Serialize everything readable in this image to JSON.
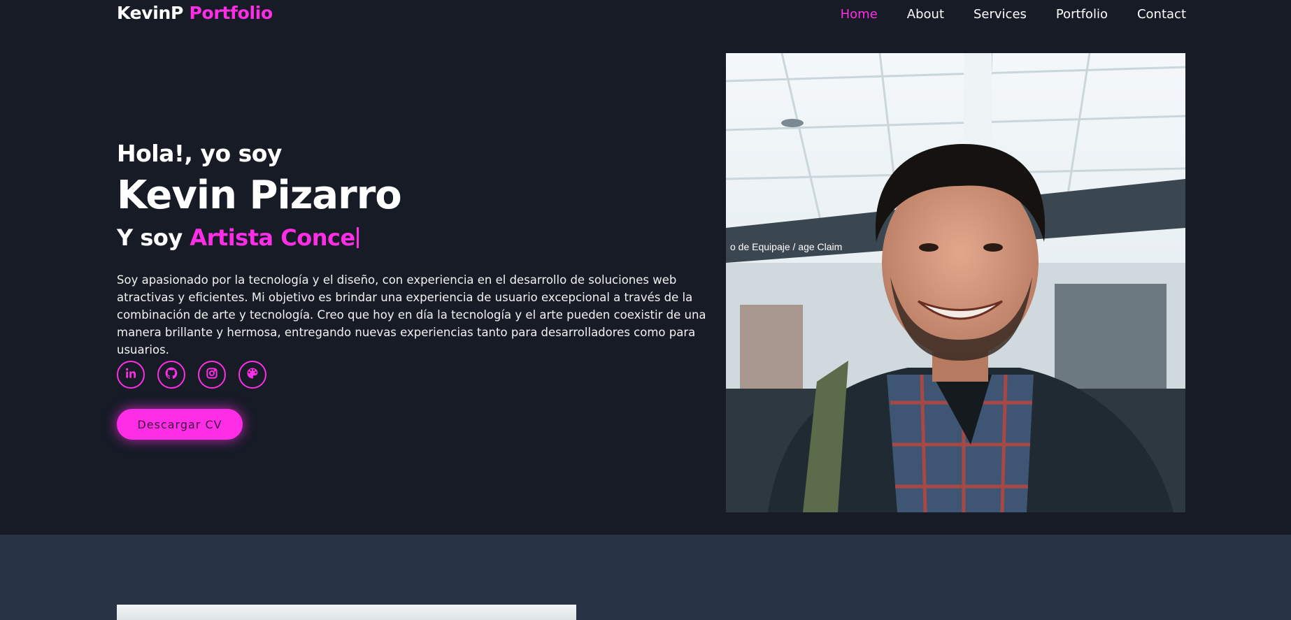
{
  "header": {
    "logo_main": "KevinP",
    "logo_accent": "Portfolio",
    "nav": [
      {
        "label": "Home",
        "active": true
      },
      {
        "label": "About",
        "active": false
      },
      {
        "label": "Services",
        "active": false
      },
      {
        "label": "Portfolio",
        "active": false
      },
      {
        "label": "Contact",
        "active": false
      }
    ]
  },
  "hero": {
    "greeting": "Hola!, yo soy",
    "name": "Kevin Pizarro",
    "role_prefix": "Y soy",
    "role_typed": "Artista Conce",
    "description": "Soy apasionado por la tecnología y el diseño, con experiencia en el desarrollo de soluciones web atractivas y eficientes. Mi objetivo es brindar una experiencia de usuario excepcional a través de la combinación de arte y tecnología. Creo que hoy en día la tecnología y el arte pueden coexistir de una manera brillante y hermosa, entregando nuevas experiencias tanto para desarrolladores como para usuarios.",
    "socials": [
      {
        "icon": "linkedin-icon"
      },
      {
        "icon": "github-icon"
      },
      {
        "icon": "instagram-icon"
      },
      {
        "icon": "palette-icon"
      }
    ],
    "cv_button": "Descargar CV"
  },
  "photo": {
    "sign_text": "o de Equipaje / age Claim"
  },
  "colors": {
    "accent": "#ff2ee6",
    "background": "#161b26",
    "section_alt": "#283445"
  }
}
